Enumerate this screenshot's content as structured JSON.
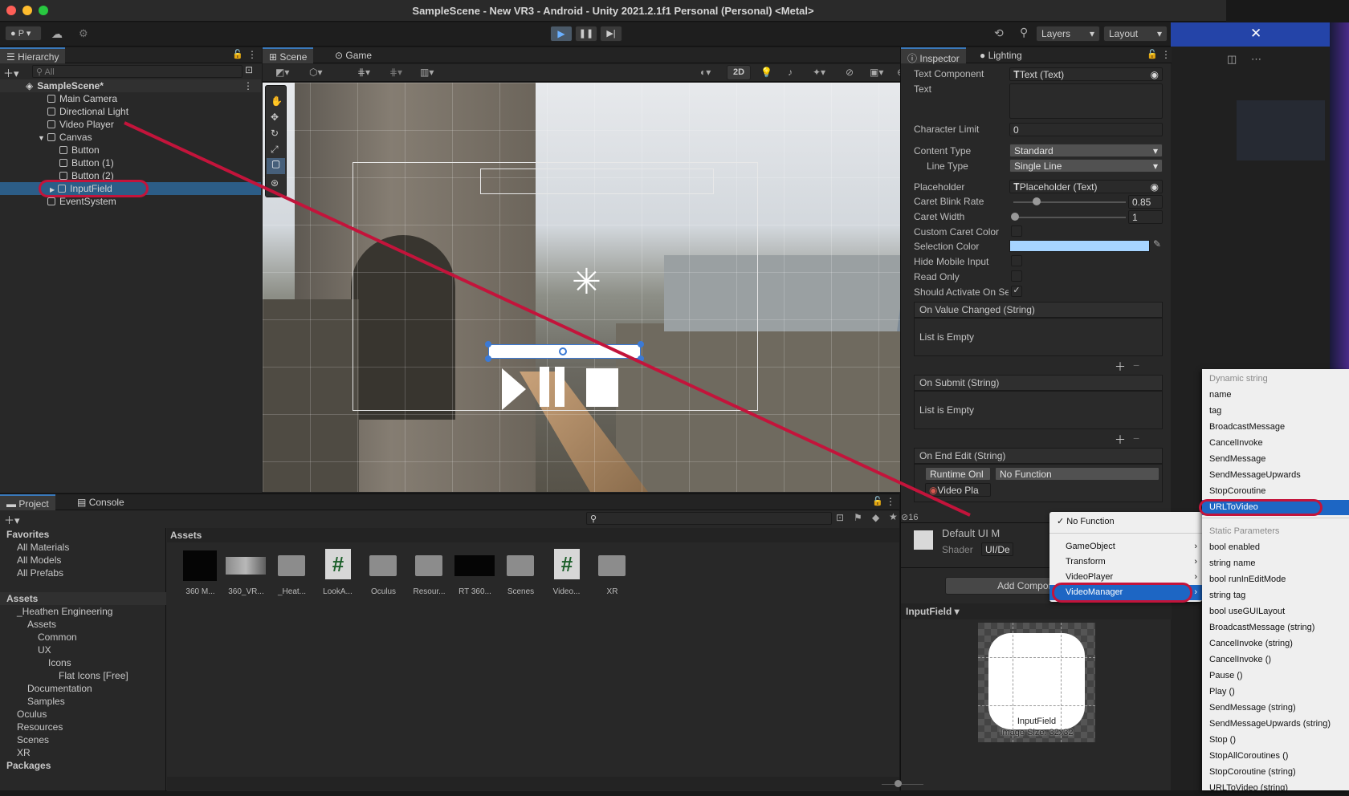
{
  "window": {
    "title": "SampleScene - New VR3 - Android - Unity 2021.2.1f1 Personal (Personal) <Metal>"
  },
  "toolbar": {
    "account": "P",
    "layers": "Layers",
    "layout": "Layout"
  },
  "hierarchy": {
    "tab": "Hierarchy",
    "search_placeholder": "All",
    "items": [
      {
        "label": "SampleScene*"
      },
      {
        "label": "Main Camera"
      },
      {
        "label": "Directional Light"
      },
      {
        "label": "Video Player"
      },
      {
        "label": "Canvas"
      },
      {
        "label": "Button"
      },
      {
        "label": "Button (1)"
      },
      {
        "label": "Button (2)"
      },
      {
        "label": "InputField"
      },
      {
        "label": "EventSystem"
      }
    ]
  },
  "scene": {
    "tabs": [
      "Scene",
      "Game"
    ],
    "mode2d": "2D"
  },
  "inspector": {
    "tabs": [
      "Inspector",
      "Lighting"
    ],
    "text_component_label": "Text Component",
    "text_component_value": "Text (Text)",
    "text_label": "Text",
    "char_limit_label": "Character Limit",
    "char_limit_value": "0",
    "content_type_label": "Content Type",
    "content_type_value": "Standard",
    "line_type_label": "Line Type",
    "line_type_value": "Single Line",
    "placeholder_label": "Placeholder",
    "placeholder_value": "Placeholder (Text)",
    "caret_blink_label": "Caret Blink Rate",
    "caret_blink_value": "0.85",
    "caret_width_label": "Caret Width",
    "caret_width_value": "1",
    "custom_caret_label": "Custom Caret Color",
    "selection_color_label": "Selection Color",
    "hide_mobile_label": "Hide Mobile Input",
    "read_only_label": "Read Only",
    "should_activate_label": "Should Activate On Se",
    "on_value_changed": "On Value Changed (String)",
    "list_empty": "List is Empty",
    "on_submit": "On Submit (String)",
    "on_end_edit": "On End Edit (String)",
    "runtime": "Runtime Onl",
    "no_function": "No Function",
    "video_obj": "Video Pla",
    "material_name": "Default UI M",
    "shader_label": "Shader",
    "shader_value": "UI/De",
    "add_component": "Add Component",
    "preview_label": "InputField",
    "preview_caption_1": "InputField",
    "preview_caption_2": "Image Size: 32x32",
    "selection_color": "#a6d4ff"
  },
  "function_menu": {
    "items": [
      "No Function",
      "GameObject",
      "Transform",
      "VideoPlayer",
      "VideoManager"
    ]
  },
  "submenu": {
    "dynamic_header": "Dynamic string",
    "dynamic_items": [
      "name",
      "tag",
      "BroadcastMessage",
      "CancelInvoke",
      "SendMessage",
      "SendMessageUpwards",
      "StopCoroutine",
      "URLToVideo"
    ],
    "static_header": "Static Parameters",
    "static_items": [
      "bool enabled",
      "string name",
      "bool runInEditMode",
      "string tag",
      "bool useGUILayout",
      "BroadcastMessage (string)",
      "CancelInvoke (string)",
      "CancelInvoke ()",
      "Pause ()",
      "Play ()",
      "SendMessage (string)",
      "SendMessageUpwards (string)",
      "Stop ()",
      "StopAllCoroutines ()",
      "StopCoroutine (string)",
      "URLToVideo (string)"
    ]
  },
  "project": {
    "tabs": [
      "Project",
      "Console"
    ],
    "hidden_count": "16",
    "assets_header": "Assets",
    "tree": [
      {
        "label": "Favorites",
        "indent": 0,
        "bold": true
      },
      {
        "label": "All Materials",
        "indent": 1
      },
      {
        "label": "All Models",
        "indent": 1
      },
      {
        "label": "All Prefabs",
        "indent": 1
      },
      {
        "label": "",
        "indent": 0
      },
      {
        "label": "Assets",
        "indent": 0,
        "bold": true
      },
      {
        "label": "_Heathen Engineering",
        "indent": 1
      },
      {
        "label": "Assets",
        "indent": 2
      },
      {
        "label": "Common",
        "indent": 3
      },
      {
        "label": "UX",
        "indent": 3
      },
      {
        "label": "Icons",
        "indent": 4
      },
      {
        "label": "Flat Icons [Free]",
        "indent": 5
      },
      {
        "label": "Documentation",
        "indent": 2
      },
      {
        "label": "Samples",
        "indent": 2
      },
      {
        "label": "Oculus",
        "indent": 1
      },
      {
        "label": "Resources",
        "indent": 1
      },
      {
        "label": "Scenes",
        "indent": 1
      },
      {
        "label": "XR",
        "indent": 1
      },
      {
        "label": "Packages",
        "indent": 0,
        "bold": true
      }
    ],
    "assets": [
      {
        "label": "360 M...",
        "kind": "black"
      },
      {
        "label": "360_VR...",
        "kind": "thumb"
      },
      {
        "label": "_Heat...",
        "kind": "folder"
      },
      {
        "label": "LookA...",
        "kind": "script"
      },
      {
        "label": "Oculus",
        "kind": "folder"
      },
      {
        "label": "Resour...",
        "kind": "folder"
      },
      {
        "label": "RT 360...",
        "kind": "blackwide"
      },
      {
        "label": "Scenes",
        "kind": "folder"
      },
      {
        "label": "Video...",
        "kind": "script"
      },
      {
        "label": "XR",
        "kind": "folder"
      }
    ]
  },
  "colors": {
    "accent": "#3a79bb",
    "highlight_red": "#c3143b",
    "selected_row": "#2c5d87"
  }
}
